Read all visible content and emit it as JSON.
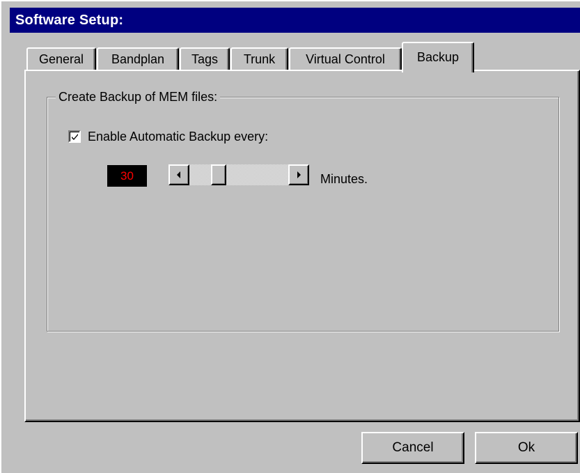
{
  "window": {
    "title": "Software Setup:"
  },
  "tabs": [
    {
      "label": "General",
      "active": false
    },
    {
      "label": "Bandplan",
      "active": false
    },
    {
      "label": "Tags",
      "active": false
    },
    {
      "label": "Trunk",
      "active": false
    },
    {
      "label": "Virtual Control",
      "active": false
    },
    {
      "label": "Backup",
      "active": true
    }
  ],
  "backup": {
    "group_label": "Create Backup of MEM files:",
    "enable_label": "Enable Automatic Backup every:",
    "enable_checked": true,
    "interval_value": "30",
    "interval_unit": "Minutes.",
    "led_color": "#ff0000"
  },
  "buttons": {
    "cancel": "Cancel",
    "ok": "Ok"
  },
  "colors": {
    "titlebar": "#000080",
    "face": "#c0c0c0"
  }
}
